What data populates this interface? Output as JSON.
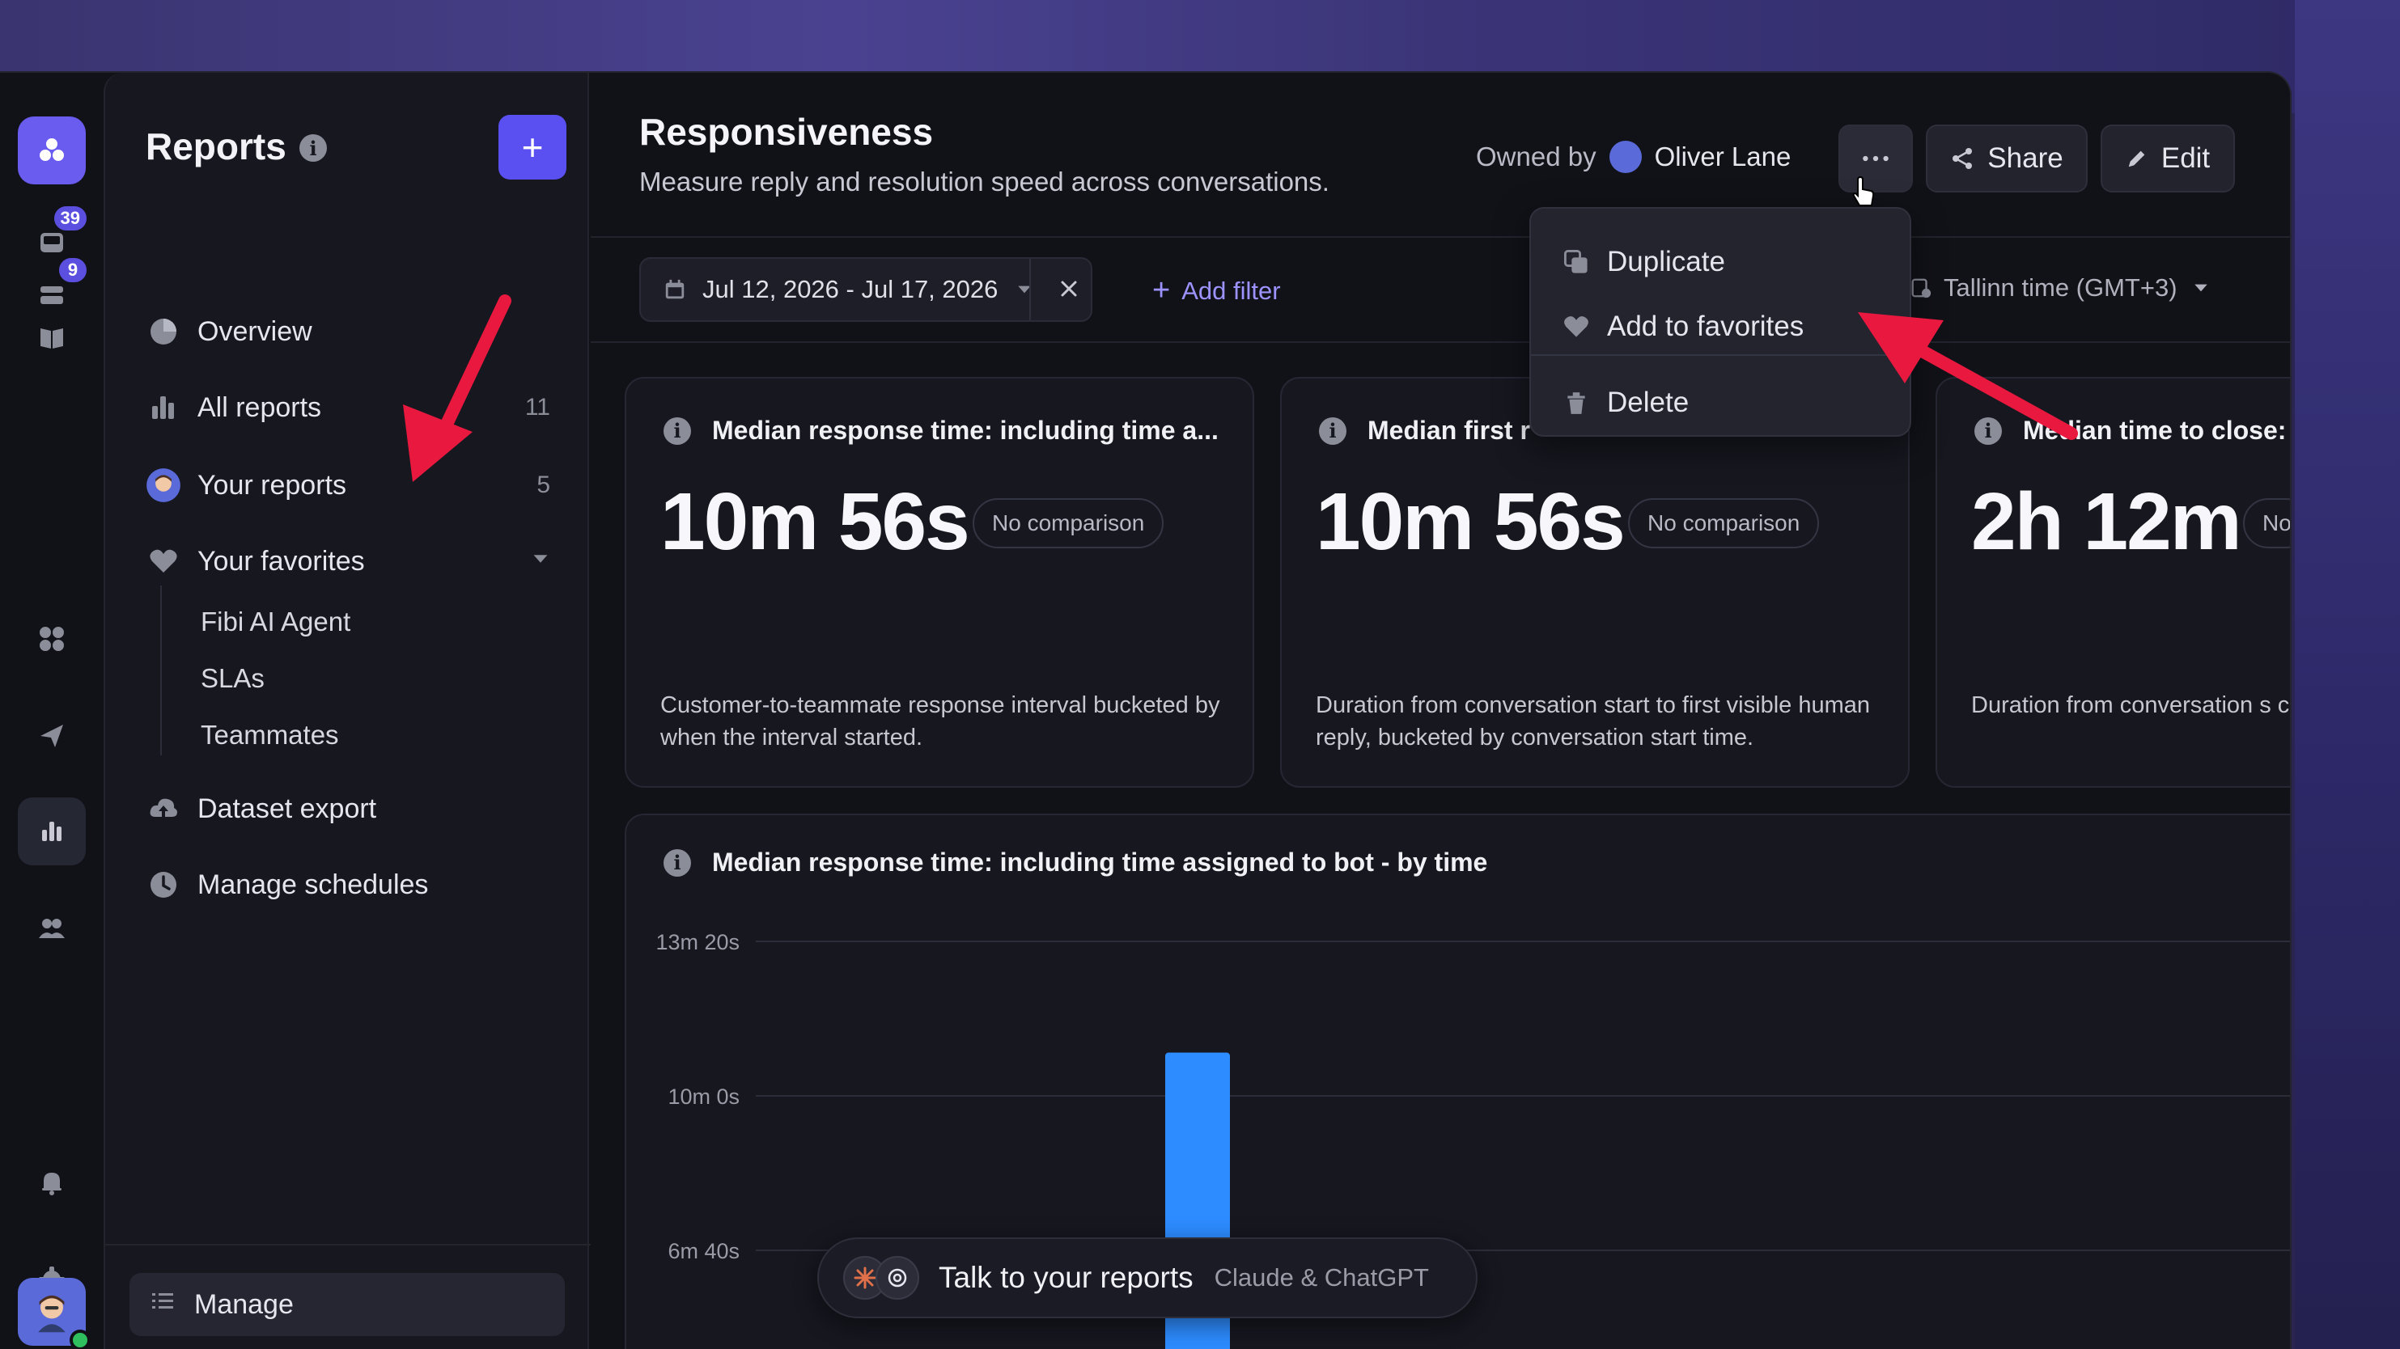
{
  "colors": {
    "accent": "#5a4ff0",
    "bar": "#2d8cff",
    "annotation_arrow": "#e8183f"
  },
  "rail": {
    "badges": {
      "inbox": "39",
      "tickets": "9"
    }
  },
  "sidebar": {
    "title": "Reports",
    "items": [
      {
        "label": "Overview",
        "icon": "pie-chart-icon"
      },
      {
        "label": "All reports",
        "icon": "bar-chart-icon",
        "count": "11"
      },
      {
        "label": "Your reports",
        "icon": "user-avatar",
        "count": "5"
      },
      {
        "label": "Your favorites",
        "icon": "heart-icon"
      },
      {
        "label": "Dataset export",
        "icon": "cloud-upload-icon"
      },
      {
        "label": "Manage schedules",
        "icon": "clock-icon"
      }
    ],
    "favorites": [
      "Fibi AI Agent",
      "SLAs",
      "Teammates"
    ],
    "manage_label": "Manage"
  },
  "header": {
    "title": "Responsiveness",
    "subtitle": "Measure reply and resolution speed across conversations.",
    "owned_by_label": "Owned by",
    "owner_name": "Oliver Lane",
    "share_label": "Share",
    "edit_label": "Edit"
  },
  "filters": {
    "date_range": "Jul 12, 2026 - Jul 17, 2026",
    "add_filter_label": "Add filter",
    "timezone": "Tallinn time (GMT+3)"
  },
  "menu": {
    "duplicate": "Duplicate",
    "add_to_favorites": "Add to favorites",
    "delete": "Delete"
  },
  "cards": [
    {
      "title": "Median response time: including time a...",
      "value": "10m 56s",
      "comparison": "No comparison",
      "description": "Customer-to-teammate response interval bucketed by when the interval started."
    },
    {
      "title": "Median first r",
      "value": "10m 56s",
      "comparison": "No comparison",
      "description": "Duration from conversation start to first visible human reply, bucketed by conversation start time."
    },
    {
      "title": "Median time to close:",
      "value": "2h 12m",
      "comparison": "No",
      "description": "Duration from conversation s close."
    }
  ],
  "chart_data": {
    "type": "bar",
    "title": "Median response time: including time assigned to bot - by time",
    "y_ticks": [
      "13m 20s",
      "10m 0s",
      "6m 40s"
    ],
    "y_tick_seconds": [
      800,
      600,
      400
    ],
    "values_seconds": [
      656
    ],
    "grid": true
  },
  "talk": {
    "label": "Talk to your reports",
    "sub": "Claude & ChatGPT"
  }
}
